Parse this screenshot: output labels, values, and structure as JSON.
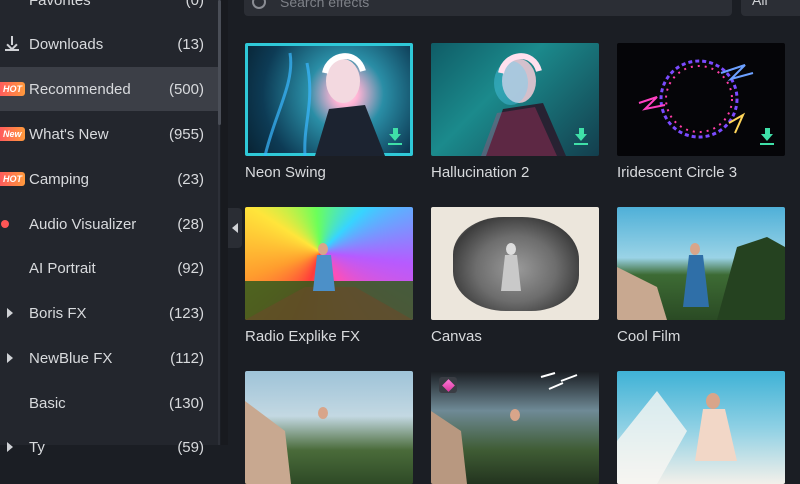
{
  "sidebar": {
    "items": [
      {
        "label": "Favorites",
        "count": "(0)"
      },
      {
        "label": "Downloads",
        "count": "(13)"
      },
      {
        "label": "Recommended",
        "count": "(500)",
        "badge": "HOT"
      },
      {
        "label": "What's New",
        "count": "(955)",
        "badge": "New"
      },
      {
        "label": "Camping",
        "count": "(23)",
        "badge": "HOT"
      },
      {
        "label": "Audio Visualizer",
        "count": "(28)"
      },
      {
        "label": "AI Portrait",
        "count": "(92)"
      },
      {
        "label": "Boris FX",
        "count": "(123)"
      },
      {
        "label": "NewBlue FX",
        "count": "(112)"
      },
      {
        "label": "Basic",
        "count": "(130)"
      },
      {
        "label": "Ty",
        "count": "(59)"
      }
    ]
  },
  "search": {
    "placeholder": "Search effects"
  },
  "filter": {
    "selected": "All"
  },
  "effects": [
    {
      "name": "Neon Swing",
      "icon": "download-icon"
    },
    {
      "name": "Hallucination 2",
      "icon": "download-icon"
    },
    {
      "name": "Iridescent Circle 3",
      "icon": "download-icon"
    },
    {
      "name": "Radio Explike FX"
    },
    {
      "name": "Canvas"
    },
    {
      "name": "Cool Film"
    },
    {
      "name": ""
    },
    {
      "name": "",
      "icon": "premium-gem-icon"
    },
    {
      "name": ""
    }
  ],
  "colors": {
    "accent_download": "#3fe0a8",
    "hot_badge": "#ff7a45",
    "selected_row": "#3c3f47"
  }
}
